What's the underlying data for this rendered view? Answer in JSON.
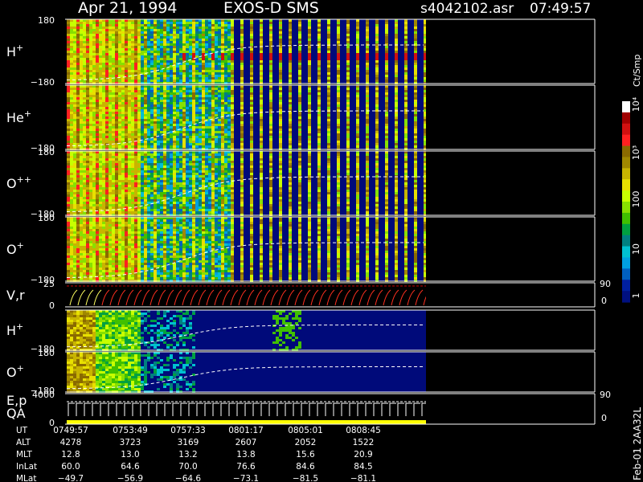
{
  "header": {
    "date": "Apr 21, 1994",
    "instrument": "EXOS-D SMS",
    "file": "s4042102.asr",
    "time": "07:49:57"
  },
  "colorbar": {
    "unit": "Ct/Smp",
    "ticks": [
      "10⁴",
      "10³",
      "100",
      "10",
      "1"
    ],
    "colors": [
      "#ffffff",
      "#a00000",
      "#d01010",
      "#ff2020",
      "#8a6a00",
      "#a08800",
      "#c8b400",
      "#e8e000",
      "#c8ff00",
      "#88e000",
      "#40c000",
      "#00a040",
      "#008080",
      "#00c0d0",
      "#00a0e0",
      "#0060c0",
      "#0020a0",
      "#001080"
    ]
  },
  "panels": [
    {
      "id": "h-plus",
      "label": "H",
      "sup": "+",
      "top": "180",
      "bottom": "−180"
    },
    {
      "id": "he-plus",
      "label": "He",
      "sup": "+",
      "top": "",
      "bottom": "−180"
    },
    {
      "id": "o-plusplus",
      "label": "O",
      "sup": "++",
      "top": "180",
      "bottom": "−180"
    },
    {
      "id": "o-plus",
      "label": "O",
      "sup": "+",
      "top": "180",
      "bottom": "−180"
    },
    {
      "id": "vr",
      "label": "V,r",
      "sup": "",
      "top": "25",
      "bottom": "0",
      "right_top": "90",
      "right_bottom": "0"
    },
    {
      "id": "h-plus-2",
      "label": "H",
      "sup": "+",
      "top": "",
      "bottom": "−180"
    },
    {
      "id": "o-plus-2",
      "label": "O",
      "sup": "+",
      "top": "180",
      "bottom": "−180"
    },
    {
      "id": "ep-qa",
      "label": "E,p",
      "label2": "QA",
      "sup": "",
      "top": "4000",
      "bottom": "0",
      "right_top": "90",
      "right_bottom": "0"
    }
  ],
  "side_label": "Feb-01 2AA32L",
  "ephemeris": {
    "rows": [
      {
        "name": "UT",
        "values": [
          "0749:57",
          "0753:49",
          "0757:33",
          "0801:17",
          "0805:01",
          "0808:45"
        ]
      },
      {
        "name": "ALT",
        "values": [
          "4278",
          "3723",
          "3169",
          "2607",
          "2052",
          "1522"
        ]
      },
      {
        "name": "MLT",
        "values": [
          "12.8",
          "13.0",
          "13.2",
          "13.8",
          "15.6",
          "20.9"
        ]
      },
      {
        "name": "InLat",
        "values": [
          "60.0",
          "64.6",
          "70.0",
          "76.6",
          "84.6",
          "84.5"
        ]
      },
      {
        "name": "MLat",
        "values": [
          "−49.7",
          "−56.9",
          "−64.6",
          "−73.1",
          "−81.5",
          "−81.1"
        ]
      }
    ]
  },
  "chart_data": {
    "type": "heatmap",
    "x": [
      "0749:57",
      "0753:49",
      "0757:33",
      "0801:17",
      "0805:01",
      "0808:45"
    ],
    "panels": [
      "H⁺",
      "He⁺",
      "O⁺⁺",
      "O⁺",
      "V,r",
      "H⁺",
      "O⁺",
      "E,p QA"
    ],
    "ylim": [
      -180,
      180
    ],
    "color_scale": "log",
    "color_range": [
      1,
      10000
    ]
  }
}
